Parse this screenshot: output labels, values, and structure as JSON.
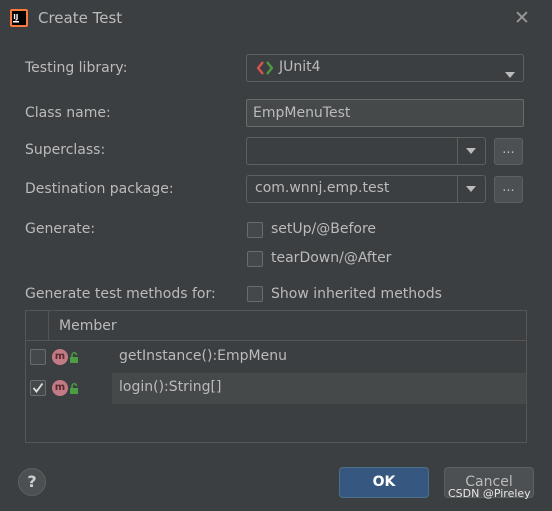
{
  "window": {
    "title": "Create Test",
    "close_icon": "close-icon"
  },
  "form": {
    "testing_library": {
      "label": "Testing library:",
      "value": "JUnit4"
    },
    "class_name": {
      "label": "Class name:",
      "value": "EmpMenuTest"
    },
    "superclass": {
      "label": "Superclass:",
      "value": "",
      "browse_label": "..."
    },
    "destination_package": {
      "label": "Destination package:",
      "value": "com.wnnj.emp.test",
      "browse_label": "..."
    },
    "generate": {
      "label": "Generate:",
      "options": [
        {
          "label": "setUp/@Before",
          "checked": false
        },
        {
          "label": "tearDown/@After",
          "checked": false
        }
      ]
    },
    "methods_for": {
      "label": "Generate test methods for:",
      "show_inherited_label": "Show inherited methods",
      "show_inherited_checked": false
    }
  },
  "table": {
    "header": "Member",
    "rows": [
      {
        "checked": false,
        "badge": "m",
        "member": "getInstance():EmpMenu"
      },
      {
        "checked": true,
        "badge": "m",
        "member": "login():String[]"
      }
    ]
  },
  "footer": {
    "help_label": "?",
    "ok_label": "OK",
    "cancel_label": "Cancel",
    "watermark": "CSDN @Pireley"
  },
  "colors": {
    "accent": "#365880",
    "badge": "#c27b85",
    "lock": "#4d9e43"
  }
}
